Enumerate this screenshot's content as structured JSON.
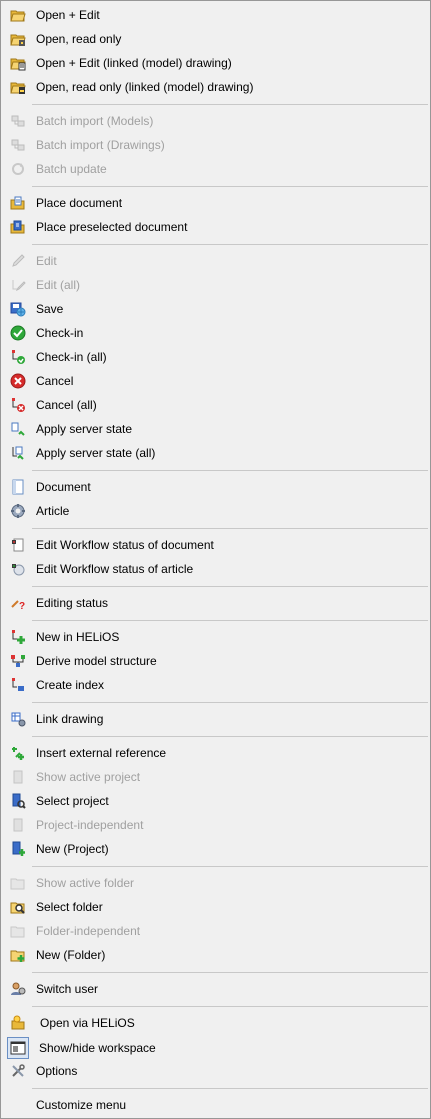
{
  "menu": {
    "items": [
      {
        "label": "Open + Edit",
        "icon": "folder-open-icon",
        "enabled": true
      },
      {
        "label": "Open, read only",
        "icon": "folder-lock-icon",
        "enabled": true
      },
      {
        "label": "Open + Edit (linked (model) drawing)",
        "icon": "folder-linked-icon",
        "enabled": true
      },
      {
        "label": "Open, read only (linked (model) drawing)",
        "icon": "folder-linked-lock-icon",
        "enabled": true
      },
      {
        "label": "Batch import (Models)",
        "icon": "batch-import-models-icon",
        "enabled": false
      },
      {
        "label": "Batch import (Drawings)",
        "icon": "batch-import-drawings-icon",
        "enabled": false
      },
      {
        "label": "Batch update",
        "icon": "batch-update-icon",
        "enabled": false
      },
      {
        "label": "Place document",
        "icon": "place-document-icon",
        "enabled": true
      },
      {
        "label": "Place preselected document",
        "icon": "place-preselected-document-icon",
        "enabled": true
      },
      {
        "label": "Edit",
        "icon": "pencil-icon",
        "enabled": false
      },
      {
        "label": "Edit (all)",
        "icon": "pencil-tree-icon",
        "enabled": false
      },
      {
        "label": "Save",
        "icon": "save-globe-icon",
        "enabled": true
      },
      {
        "label": "Check-in",
        "icon": "check-icon",
        "enabled": true
      },
      {
        "label": "Check-in (all)",
        "icon": "check-tree-icon",
        "enabled": true
      },
      {
        "label": "Cancel",
        "icon": "cancel-icon",
        "enabled": true
      },
      {
        "label": "Cancel (all)",
        "icon": "cancel-tree-icon",
        "enabled": true
      },
      {
        "label": "Apply server state",
        "icon": "server-state-icon",
        "enabled": true
      },
      {
        "label": "Apply server state (all)",
        "icon": "server-state-tree-icon",
        "enabled": true
      },
      {
        "label": "Document",
        "icon": "document-icon",
        "enabled": true
      },
      {
        "label": "Article",
        "icon": "article-gear-icon",
        "enabled": true
      },
      {
        "label": "Edit Workflow status of document",
        "icon": "workflow-document-icon",
        "enabled": true
      },
      {
        "label": "Edit Workflow status of article",
        "icon": "workflow-article-icon",
        "enabled": true
      },
      {
        "label": "Editing status",
        "icon": "editing-status-icon",
        "enabled": true
      },
      {
        "label": "New in HELiOS",
        "icon": "new-in-helios-icon",
        "enabled": true
      },
      {
        "label": "Derive model structure",
        "icon": "derive-structure-icon",
        "enabled": true
      },
      {
        "label": "Create index",
        "icon": "create-index-icon",
        "enabled": true
      },
      {
        "label": "Link drawing",
        "icon": "link-drawing-icon",
        "enabled": true
      },
      {
        "label": "Insert external reference",
        "icon": "insert-reference-icon",
        "enabled": true
      },
      {
        "label": "Show active project",
        "icon": "project-show-icon",
        "enabled": false
      },
      {
        "label": "Select project",
        "icon": "project-select-icon",
        "enabled": true
      },
      {
        "label": "Project-independent",
        "icon": "project-independent-icon",
        "enabled": false
      },
      {
        "label": "New (Project)",
        "icon": "project-new-icon",
        "enabled": true
      },
      {
        "label": "Show active folder",
        "icon": "folder-show-icon",
        "enabled": false
      },
      {
        "label": "Select folder",
        "icon": "folder-select-icon",
        "enabled": true
      },
      {
        "label": "Folder-independent",
        "icon": "folder-independent-icon",
        "enabled": false
      },
      {
        "label": "New (Folder)",
        "icon": "folder-new-icon",
        "enabled": true
      },
      {
        "label": "Switch user",
        "icon": "switch-user-icon",
        "enabled": true
      },
      {
        "label": "Open via HELiOS",
        "icon": "open-via-helios-icon",
        "enabled": true
      },
      {
        "label": "Show/hide workspace",
        "icon": "workspace-icon",
        "enabled": true
      },
      {
        "label": "Options",
        "icon": "options-tools-icon",
        "enabled": true
      },
      {
        "label": "Customize menu",
        "icon": "",
        "enabled": true
      }
    ]
  }
}
